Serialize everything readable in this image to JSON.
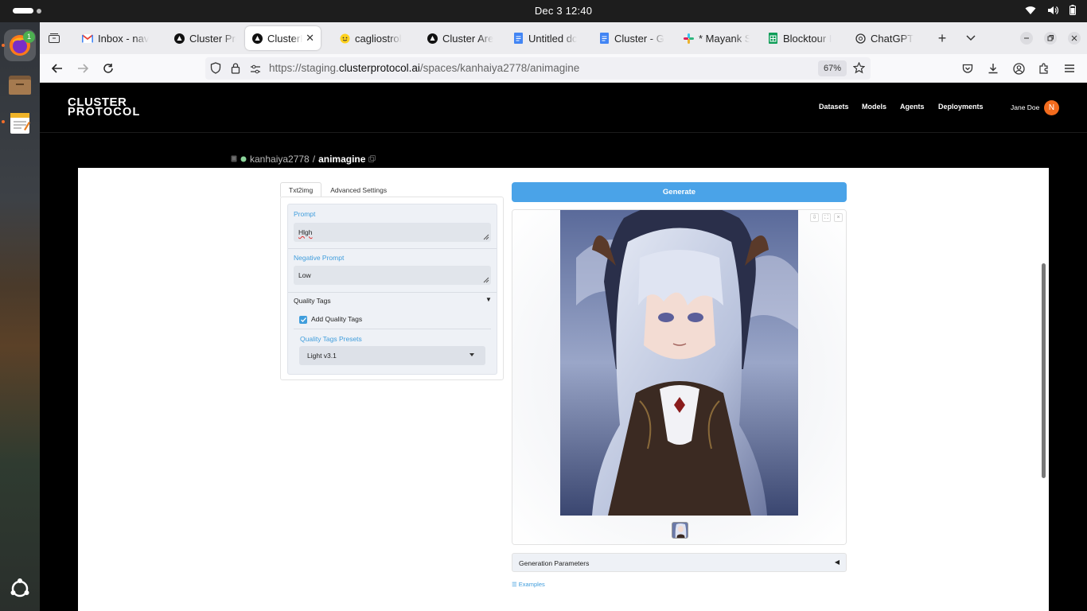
{
  "system": {
    "clock": "Dec 3  12:40",
    "dock_badge": "1"
  },
  "browser": {
    "tabs": [
      {
        "title": "Inbox - nav",
        "icon": "gmail-icon"
      },
      {
        "title": "Cluster Pro",
        "icon": "cluster-icon"
      },
      {
        "title": "ClusterP",
        "icon": "cluster-icon",
        "selected": true
      },
      {
        "title": "cagliostrol",
        "icon": "hugging-face-icon"
      },
      {
        "title": "Cluster Are",
        "icon": "cluster-icon"
      },
      {
        "title": "Untitled dc",
        "icon": "google-docs-icon"
      },
      {
        "title": "Cluster - G",
        "icon": "google-docs-icon"
      },
      {
        "title": "* Mayank S",
        "icon": "slack-icon"
      },
      {
        "title": "Blocktour I",
        "icon": "google-sheets-icon"
      },
      {
        "title": "ChatGPT",
        "icon": "chatgpt-icon"
      }
    ],
    "url_prefix": "https://staging.",
    "url_host": "clusterprotocol.ai",
    "url_path": "/spaces/kanhaiya2778/animagine",
    "zoom": "67%"
  },
  "site": {
    "logo_line1": "CLUSTER",
    "logo_line2": "PROTOCOL",
    "nav": [
      "Datasets",
      "Models",
      "Agents",
      "Deployments"
    ],
    "user_name": "Jane Doe",
    "avatar_initial": "N",
    "breadcrumb_user": "kanhaiya2778",
    "breadcrumb_sep": "/",
    "breadcrumb_repo": "animagine"
  },
  "app": {
    "tabs": [
      "Txt2img",
      "Advanced Settings"
    ],
    "prompt_label": "Prompt",
    "prompt_value": "Hlgh",
    "negative_label": "Negative Prompt",
    "negative_value": "Low",
    "quality_tags_label": "Quality Tags",
    "quality_tags_caret": "▼",
    "add_quality_tags_label": "Add Quality Tags",
    "add_quality_tags_checked": true,
    "presets_label": "Quality Tags Presets",
    "preset_value": "Light v3.1",
    "generate_label": "Generate",
    "generation_params_label": "Generation Parameters",
    "generation_params_caret": "◀",
    "examples_label": "☰ Examples"
  },
  "colors": {
    "accent_blue": "#4aa3e8",
    "label_blue": "#3f9ddc",
    "avatar_orange": "#f26b1d"
  }
}
